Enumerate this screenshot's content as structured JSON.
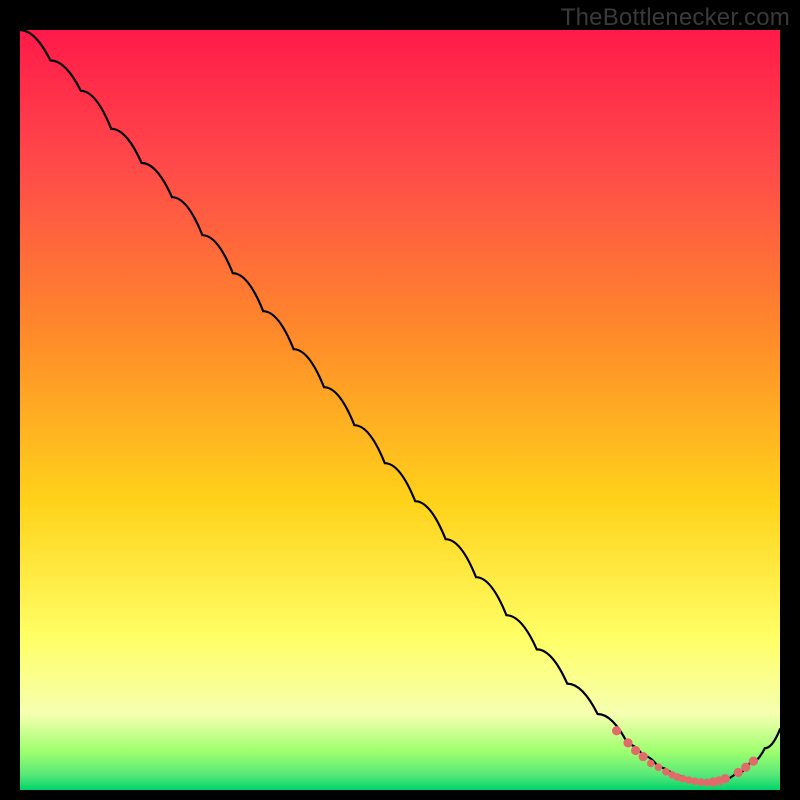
{
  "watermark": "TheBottlenecker.com",
  "colors": {
    "bg_black": "#000000",
    "grad_top": "#ff1a4a",
    "grad_mid1": "#ff6a3a",
    "grad_mid2": "#ffd21a",
    "grad_low1": "#ffff66",
    "grad_low2": "#f6ffb0",
    "grad_green1": "#9cff6e",
    "grad_green2": "#00d46a",
    "curve": "#000000",
    "dot_fill": "#e26a6a",
    "dot_stroke": "#c44848"
  },
  "chart_data": {
    "type": "line",
    "title": "",
    "xlabel": "",
    "ylabel": "",
    "xlim": [
      0,
      100
    ],
    "ylim": [
      0,
      100
    ],
    "series": [
      {
        "name": "curve",
        "x": [
          0,
          4,
          8,
          12,
          16,
          20,
          24,
          28,
          32,
          36,
          40,
          44,
          48,
          52,
          56,
          60,
          64,
          68,
          72,
          76,
          80,
          82,
          84,
          86,
          88,
          90,
          92,
          94,
          96,
          98,
          100
        ],
        "y": [
          100,
          96,
          92,
          87,
          82.5,
          78,
          73,
          68,
          63,
          58,
          53,
          48,
          43,
          38,
          33,
          28,
          23,
          18.5,
          14,
          10,
          6,
          4.5,
          3,
          2,
          1.3,
          1,
          1.2,
          2,
          3.5,
          5.5,
          8
        ]
      }
    ],
    "dots": [
      {
        "x": 78.5,
        "y": 7.8
      },
      {
        "x": 80.0,
        "y": 6.2
      },
      {
        "x": 81.0,
        "y": 5.2
      },
      {
        "x": 82.0,
        "y": 4.4
      },
      {
        "x": 83.0,
        "y": 3.5
      },
      {
        "x": 84.0,
        "y": 3.0
      },
      {
        "x": 85.0,
        "y": 2.4
      },
      {
        "x": 85.8,
        "y": 2.0
      },
      {
        "x": 86.5,
        "y": 1.7
      },
      {
        "x": 87.2,
        "y": 1.5
      },
      {
        "x": 88.0,
        "y": 1.3
      },
      {
        "x": 88.8,
        "y": 1.15
      },
      {
        "x": 89.6,
        "y": 1.05
      },
      {
        "x": 90.4,
        "y": 1.0
      },
      {
        "x": 91.2,
        "y": 1.05
      },
      {
        "x": 92.0,
        "y": 1.2
      },
      {
        "x": 92.8,
        "y": 1.5
      },
      {
        "x": 94.5,
        "y": 2.3
      },
      {
        "x": 95.5,
        "y": 3.0
      },
      {
        "x": 96.5,
        "y": 3.8
      }
    ],
    "dot_radius": 4.6,
    "dot_radius_small": 3.8
  }
}
